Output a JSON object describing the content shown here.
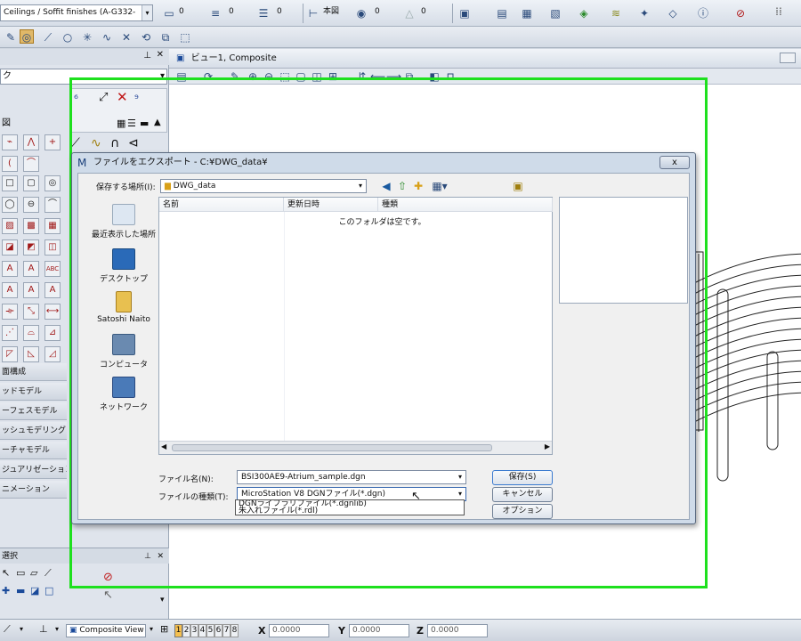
{
  "toolbar": {
    "level_combo": "Ceilings / Soffit finishes (A-G332-",
    "counter_a": "0",
    "counter_b": "0",
    "counter_c": "0",
    "counter_d": "0",
    "counter_e": "0",
    "model_combo": "本図"
  },
  "left_panel": {
    "combo_text": "ク",
    "section_label": "図",
    "categories": [
      "面構成",
      "ッドモデル",
      "ーフェスモデル",
      "ッシュモデリング",
      "ーチャモデル",
      "ジュアリゼーション",
      "ニメーション"
    ],
    "bottom_label": "選択",
    "view_combo": "Composite View"
  },
  "view": {
    "title": "ビュー1, Composite"
  },
  "dialog": {
    "title": "ファイルをエクスポート - C:¥DWG_data¥",
    "save_in_label": "保存する場所(I):",
    "save_in_value": "DWG_data",
    "places": [
      {
        "label": "最近表示した場所"
      },
      {
        "label": "デスクトップ"
      },
      {
        "label": "Satoshi Naito"
      },
      {
        "label": "コンピュータ"
      },
      {
        "label": "ネットワーク"
      }
    ],
    "columns": [
      "名前",
      "更新日時",
      "種類"
    ],
    "empty_message": "このフォルダは空です。",
    "filename_label": "ファイル名(N):",
    "filename_value": "BSI300AE9-Atrium_sample.dgn",
    "filetype_label": "ファイルの種類(T):",
    "filetype_value": "MicroStation V8 DGNファイル(*.dgn)",
    "filetype_options": [
      "DGNライブラリファイル(*.dgnlib)",
      "朱入れファイル(*.rdl)"
    ],
    "save_button": "保存(S)",
    "cancel_button": "キャンセル",
    "options_button": "オプション",
    "close_button": "x"
  },
  "status": {
    "view_combo": "Composite View",
    "view_numbers": [
      "1",
      "2",
      "3",
      "4",
      "5",
      "6",
      "7",
      "8"
    ],
    "x_label": "X",
    "x_value": "0.0000",
    "y_label": "Y",
    "y_value": "0.0000",
    "z_label": "Z",
    "z_value": "0.0000"
  },
  "colors": {
    "highlight_frame": "#1ee01e",
    "dialog_bg": "#cfdbe9"
  }
}
